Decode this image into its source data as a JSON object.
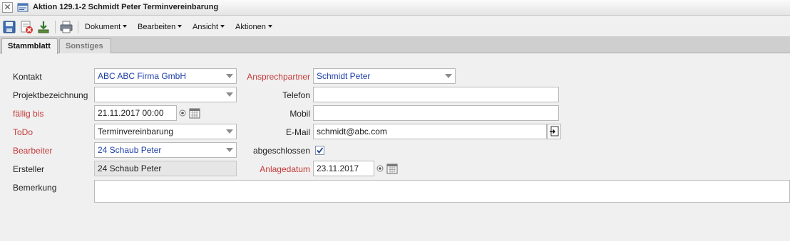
{
  "window": {
    "title": "Aktion 129.1-2 Schmidt Peter Terminvereinbarung",
    "close_glyph": "✕"
  },
  "toolbar": {
    "icons": [
      "save-icon",
      "delete-icon",
      "download-icon",
      "print-icon"
    ],
    "menus": {
      "dokument": "Dokument",
      "bearbeiten": "Bearbeiten",
      "ansicht": "Ansicht",
      "aktionen": "Aktionen"
    }
  },
  "tabs": {
    "stammblatt": "Stammblatt",
    "sonstiges": "Sonstiges"
  },
  "form": {
    "kontakt": {
      "label": "Kontakt",
      "value": "ABC ABC Firma GmbH"
    },
    "ansprechpartner": {
      "label": "Ansprechpartner",
      "value": "Schmidt Peter"
    },
    "projektbezeichnung": {
      "label": "Projektbezeichnung",
      "value": ""
    },
    "telefon": {
      "label": "Telefon",
      "value": ""
    },
    "faellig_bis": {
      "label": "fällig bis",
      "value": "21.11.2017 00:00"
    },
    "mobil": {
      "label": "Mobil",
      "value": ""
    },
    "todo": {
      "label": "ToDo",
      "value": "Terminvereinbarung"
    },
    "email": {
      "label": "E-Mail",
      "value": "schmidt@abc.com"
    },
    "bearbeiter": {
      "label": "Bearbeiter",
      "value": "24 Schaub Peter"
    },
    "abgeschlossen": {
      "label": "abgeschlossen",
      "checked": true
    },
    "ersteller": {
      "label": "Ersteller",
      "value": "24 Schaub Peter"
    },
    "anlagedatum": {
      "label": "Anlagedatum",
      "value": "23.11.2017"
    },
    "bemerkung": {
      "label": "Bemerkung",
      "value": ""
    }
  },
  "colors": {
    "required_label": "#c43a3a",
    "link_value": "#1c3ea8"
  }
}
